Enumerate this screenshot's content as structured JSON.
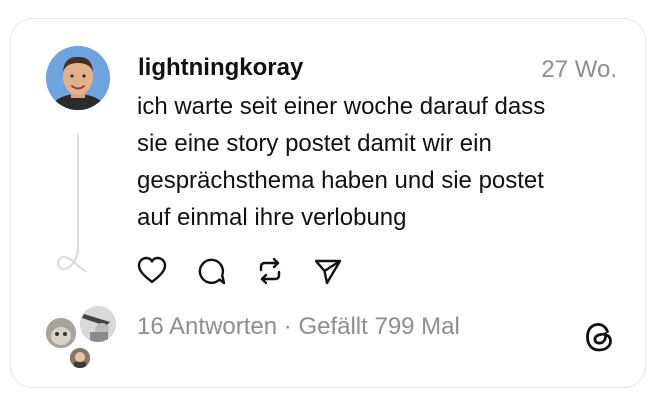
{
  "post": {
    "username": "lightningkoray",
    "timestamp": "27 Wo.",
    "text_lines": [
      "ich warte seit einer woche darauf dass",
      "sie eine story postet damit wir ein",
      "gesprächsthema haben und sie postet",
      "auf einmal ihre verlobung"
    ]
  },
  "actions": {
    "like_icon": "heart-icon",
    "reply_icon": "comment-icon",
    "repost_icon": "repost-icon",
    "share_icon": "send-icon"
  },
  "stats": {
    "replies": "16 Antworten",
    "separator": " · ",
    "likes": "Gefällt 799 Mal"
  },
  "colors": {
    "text_primary": "#111111",
    "text_secondary": "#8e8e8e",
    "border": "#e6e6e6",
    "thread_line": "#dcdcdc"
  }
}
